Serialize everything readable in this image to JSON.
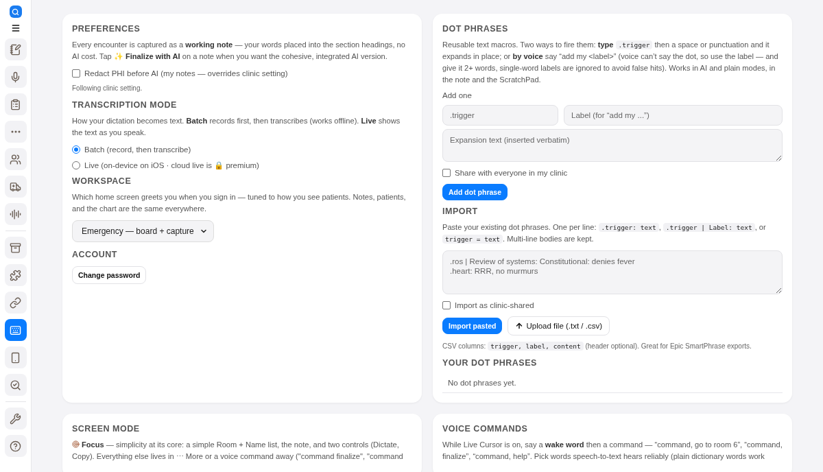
{
  "sidebar": {
    "groups": [
      {
        "items": [
          {
            "selected": false
          },
          {
            "selected": false
          },
          {
            "selected": false
          },
          {
            "selected": false
          },
          {
            "selected": false
          },
          {
            "selected": false
          },
          {
            "selected": false
          }
        ]
      },
      {
        "items": [
          {
            "selected": false
          },
          {
            "selected": false
          },
          {
            "selected": false
          },
          {
            "selected": true
          },
          {
            "selected": false
          },
          {
            "selected": false
          }
        ]
      },
      {
        "items": [
          {
            "selected": false
          },
          {
            "selected": false
          }
        ]
      }
    ]
  },
  "cards": [
    {
      "sections": [
        {
          "heading": "PREFERENCES",
          "blocks": [
            {
              "kind": "paragraph",
              "segments": [
                {
                  "kind": "text",
                  "text": "Every encounter is captured as a **working note** — your words placed into the section headings, no AI cost. Tap ✨ **Finalize with AI** on a note when you want the cohesive, integrated AI version."
                }
              ]
            },
            {
              "kind": "checkbox",
              "label": "Redact PHI before AI (my notes — overrides clinic setting)",
              "checked": false
            },
            {
              "kind": "hint",
              "text": "Following clinic setting."
            }
          ]
        },
        {
          "heading": "TRANSCRIPTION MODE",
          "blocks": [
            {
              "kind": "paragraph",
              "segments": [
                {
                  "kind": "text",
                  "text": "How your dictation becomes text. **Batch** records first, then transcribes (works offline). **Live** shows the text as you speak."
                }
              ]
            },
            {
              "kind": "radio",
              "label": "Batch (record, then transcribe)",
              "selected": true
            },
            {
              "kind": "radio",
              "label": "Live (on-device on iOS · cloud live is 🔒 premium)",
              "selected": false
            }
          ]
        },
        {
          "heading": "WORKSPACE",
          "blocks": [
            {
              "kind": "paragraph",
              "segments": [
                {
                  "kind": "text",
                  "text": "Which home screen greets you when you sign in — tuned to how you see patients. Notes, patients, and the chart are the same everywhere."
                }
              ]
            },
            {
              "kind": "select",
              "value": "Emergency — board + capture"
            }
          ]
        },
        {
          "heading": "ACCOUNT",
          "blocks": [
            {
              "kind": "button",
              "label": "Change password"
            }
          ]
        }
      ]
    },
    {
      "sections": [
        {
          "heading": "DOT PHRASES",
          "blocks": [
            {
              "kind": "paragraph",
              "segments": [
                {
                  "kind": "text",
                  "text": "Reusable text macros. Two ways to fire them: **type** "
                },
                {
                  "kind": "code",
                  "text": ".trigger"
                },
                {
                  "kind": "text",
                  "text": " then a space or punctuation and it expands in place; or **by voice** say “add my <label>” (voice can’t say the dot, so use the label — and give it 2+ words, single-word labels are ignored to avoid false hits). Works in AI and plain modes, in the note and the ScratchPad."
                }
              ]
            },
            {
              "kind": "label",
              "text": "Add one"
            },
            {
              "kind": "inputs",
              "fields": [
                {
                  "placeholder": ".trigger"
                },
                {
                  "placeholder": "Label (for “add my ...”)"
                }
              ]
            },
            {
              "kind": "textarea",
              "placeholder": "Expansion text (inserted verbatim)"
            },
            {
              "kind": "checkbox",
              "label": "Share with everyone in my clinic",
              "checked": false
            },
            {
              "kind": "buttons",
              "buttons": [
                {
                  "label": "Add dot phrase",
                  "kind": "primary"
                }
              ]
            }
          ]
        },
        {
          "heading": "IMPORT",
          "blocks": [
            {
              "kind": "paragraph",
              "segments": [
                {
                  "kind": "text",
                  "text": "Paste your existing dot phrases. One per line: "
                },
                {
                  "kind": "code",
                  "text": ".trigger: text"
                },
                {
                  "kind": "text",
                  "text": ", "
                },
                {
                  "kind": "code",
                  "text": ".trigger | Label: text"
                },
                {
                  "kind": "text",
                  "text": ", or "
                },
                {
                  "kind": "code",
                  "text": "trigger = text"
                },
                {
                  "kind": "text",
                  "text": ". Multi-line bodies are kept."
                }
              ]
            },
            {
              "kind": "textarea",
              "placeholder": ".ros | Review of systems: Constitutional: denies fever\n.heart: RRR, no murmurs"
            },
            {
              "kind": "checkbox",
              "label": "Import as clinic-shared",
              "checked": false
            },
            {
              "kind": "buttons",
              "buttons": [
                {
                  "label": "Import pasted",
                  "kind": "primary"
                },
                {
                  "label": "Upload file (.txt / .csv)",
                  "kind": "upload"
                }
              ]
            },
            {
              "kind": "small",
              "segments": [
                {
                  "kind": "text",
                  "text": "CSV columns: "
                },
                {
                  "kind": "code",
                  "text": "trigger, label, content"
                },
                {
                  "kind": "text",
                  "text": " (header optional). Great for Epic SmartPhrase exports."
                }
              ]
            }
          ]
        },
        {
          "heading": "YOUR DOT PHRASES",
          "blocks": [
            {
              "kind": "empty",
              "text": "No dot phrases yet."
            }
          ]
        }
      ]
    },
    {
      "sections": [
        {
          "heading": "SCREEN MODE",
          "blocks": [
            {
              "kind": "focus_paragraph",
              "segments": [
                {
                  "kind": "text",
                  "text": "**Focus** — simplicity at its core: a simple Room + Name list, the note, and two controls (Dictate, Copy). Everything else lives in ⋯ More or a voice command away (\"command finalize\", \"command"
                }
              ]
            }
          ]
        }
      ]
    },
    {
      "sections": [
        {
          "heading": "VOICE COMMANDS",
          "blocks": [
            {
              "kind": "paragraph",
              "segments": [
                {
                  "kind": "text",
                  "text": "While Live Cursor is on, say a **wake word** then a command — “command, go to room 6”, “command, finalize”, “command, help”. Pick words speech-to-text hears reliably (plain dictionary words work"
                }
              ]
            }
          ]
        }
      ]
    }
  ]
}
